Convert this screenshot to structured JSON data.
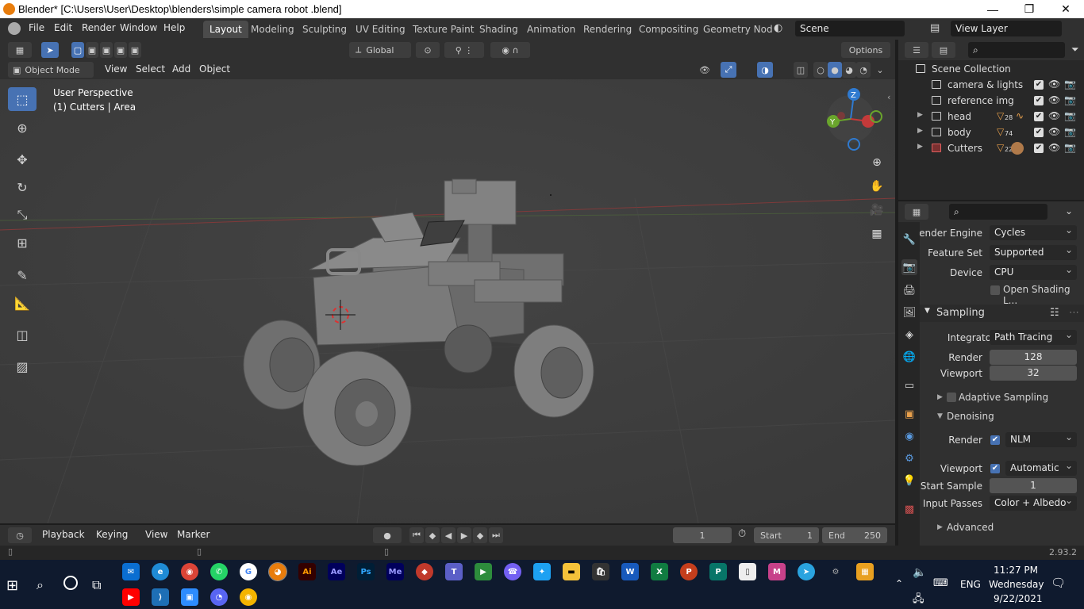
{
  "window": {
    "title": "Blender* [C:\\Users\\User\\Desktop\\blenders\\simple camera robot .blend]"
  },
  "menubar": {
    "menus": [
      "File",
      "Edit",
      "Render",
      "Window",
      "Help"
    ],
    "workspaces": [
      "Layout",
      "Modeling",
      "Sculpting",
      "UV Editing",
      "Texture Paint",
      "Shading",
      "Animation",
      "Rendering",
      "Compositing",
      "Geometry Nod"
    ],
    "active_workspace": "Layout",
    "scene": "Scene",
    "view_layer": "View Layer"
  },
  "viewport_header": {
    "transform_orientation": "Global",
    "options_label": "Options",
    "mode": "Object Mode",
    "menus": [
      "View",
      "Select",
      "Add",
      "Object"
    ]
  },
  "viewport": {
    "perspective_label": "User Perspective",
    "context_label": "(1) Cutters | Area",
    "gizmo_axes": [
      "Z",
      "Y",
      "X"
    ]
  },
  "outliner": {
    "root": "Scene Collection",
    "collections": [
      {
        "name": "camera & lights",
        "expandable": false,
        "badge": ""
      },
      {
        "name": "reference img",
        "expandable": false,
        "badge": ""
      },
      {
        "name": "head",
        "expandable": true,
        "badge": "28"
      },
      {
        "name": "body",
        "expandable": true,
        "badge": "74"
      },
      {
        "name": "Cutters",
        "expandable": true,
        "badge": "22"
      }
    ]
  },
  "properties": {
    "render_engine": {
      "label": "Render Engine",
      "value": "Cycles"
    },
    "feature_set": {
      "label": "Feature Set",
      "value": "Supported"
    },
    "device": {
      "label": "Device",
      "value": "CPU"
    },
    "open_shading": "Open Shading L...",
    "sampling": {
      "title": "Sampling",
      "integrator": {
        "label": "Integrator",
        "value": "Path Tracing"
      },
      "render": {
        "label": "Render",
        "value": "128"
      },
      "viewport": {
        "label": "Viewport",
        "value": "32"
      },
      "adaptive": "Adaptive Sampling",
      "denoising": "Denoising",
      "denoise_render": {
        "label": "Render",
        "value": "NLM"
      },
      "denoise_viewport": {
        "label": "Viewport",
        "value": "Automatic"
      },
      "start_sample": {
        "label": "Start Sample",
        "value": "1"
      },
      "input_passes": {
        "label": "Input Passes",
        "value": "Color + Albedo"
      },
      "advanced": "Advanced"
    }
  },
  "timeline": {
    "menus": [
      "Playback",
      "Keying",
      "View",
      "Marker"
    ],
    "current_frame": "1",
    "start_label": "Start",
    "start": "1",
    "end_label": "End",
    "end": "250"
  },
  "statusbar": {
    "version": "2.93.2"
  },
  "taskbar": {
    "time": "11:27 PM",
    "day": "Wednesday",
    "date": "9/22/2021",
    "language": "ENG",
    "icons_row1": [
      "Ai",
      "Ae",
      "Ps",
      "Me",
      "W",
      "X",
      "P"
    ],
    "icons_row2": []
  }
}
